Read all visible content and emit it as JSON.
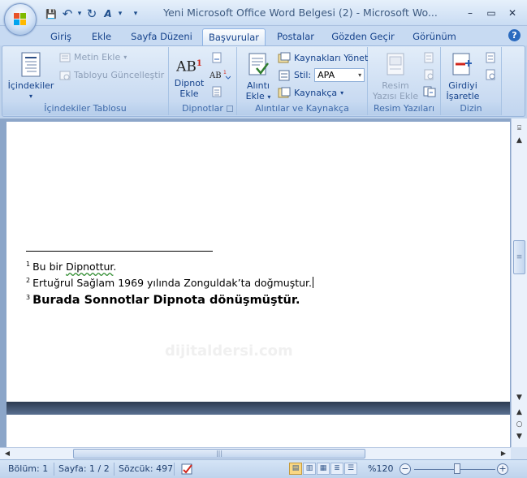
{
  "window": {
    "title": "Yeni Microsoft Office Word Belgesi (2) - Microsoft Wo...",
    "minimize_icon": "minimize-icon",
    "maximize_icon": "maximize-icon",
    "close_icon": "close-icon",
    "min_label": "–",
    "max_label": "▭",
    "close_label": "✕"
  },
  "quick_access": {
    "save": "💾",
    "undo": "↶",
    "undo_drop": "▾",
    "redo": "↻",
    "format": "A",
    "format_drop": "▾",
    "customize": "▾"
  },
  "tabs": [
    {
      "label": "Giriş"
    },
    {
      "label": "Ekle"
    },
    {
      "label": "Sayfa Düzeni"
    },
    {
      "label": "Başvurular"
    },
    {
      "label": "Postalar"
    },
    {
      "label": "Gözden Geçir"
    },
    {
      "label": "Görünüm"
    }
  ],
  "help_label": "?",
  "ribbon": {
    "toc_group": {
      "label": "İçindekiler Tablosu",
      "toc_button": "İçindekiler",
      "dropdown_arrow": "▾",
      "add_text": "Metin Ekle",
      "update_table": "Tabloyu Güncelleştir"
    },
    "footnotes_group": {
      "label": "Dipnotlar",
      "insert_footnote_line1": "Dipnot",
      "insert_footnote_line2": "Ekle",
      "ab_glyph": "AB",
      "ab_sup": "1"
    },
    "citations_group": {
      "label": "Alıntılar ve Kaynakça",
      "insert_citation_line1": "Alıntı",
      "insert_citation_line2": "Ekle",
      "manage_sources": "Kaynakları Yönet",
      "style_label": "Stil:",
      "style_value": "APA",
      "bibliography": "Kaynakça"
    },
    "captions_group": {
      "label": "Resim Yazıları",
      "insert_caption_line1": "Resim",
      "insert_caption_line2": "Yazısı Ekle"
    },
    "index_group": {
      "label": "Dizin",
      "mark_entry_line1": "Girdiyi",
      "mark_entry_line2": "İşaretle"
    }
  },
  "document": {
    "footnotes": [
      {
        "num": "1",
        "pre": "Bu bir ",
        "squiggle": "Dipnottur",
        "post": "."
      },
      {
        "num": "2",
        "text": "Ertuğrul Sağlam 1969 yılında Zonguldak’ta doğmuştur."
      },
      {
        "num": "3",
        "text": "Burada Sonnotlar Dipnota dönüşmüştür."
      }
    ],
    "watermark": "dijitaldersi.com"
  },
  "scrollbar": {
    "up": "▲",
    "down": "▼",
    "prev_page": "▲",
    "browse": "○",
    "next_page": "▼",
    "left": "◀",
    "right": "▶",
    "grip": "|||",
    "vgrip": "≡"
  },
  "status_bar": {
    "section": "Bölüm: 1",
    "page": "Sayfa: 1 / 2",
    "words": "Sözcük: 497",
    "zoom": "%120",
    "zoom_minus": "−",
    "zoom_plus": "+",
    "zoom_level_percent": 120
  }
}
